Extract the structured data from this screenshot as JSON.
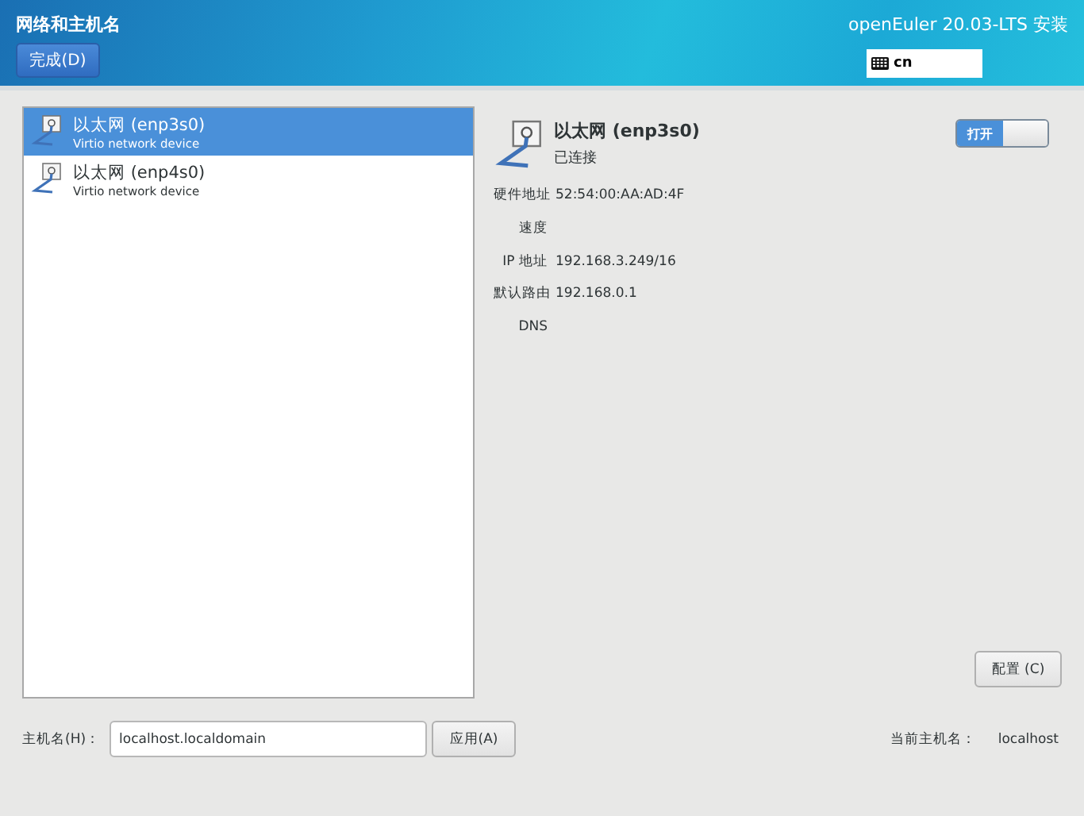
{
  "header": {
    "title": "网络和主机名",
    "done_button": "完成(D)",
    "product": "openEuler 20.03-LTS 安装",
    "keyboard_layout": "cn"
  },
  "devices": [
    {
      "name": "以太网 (enp3s0)",
      "description": "Virtio network device",
      "selected": true
    },
    {
      "name": "以太网 (enp4s0)",
      "description": "Virtio network device",
      "selected": false
    }
  ],
  "details": {
    "name": "以太网 (enp3s0)",
    "status": "已连接",
    "switch": {
      "label": "打开",
      "on": true
    },
    "fields": [
      {
        "label": "硬件地址",
        "value": "52:54:00:AA:AD:4F"
      },
      {
        "label": "速度"
      },
      {
        "label": "IP 地址",
        "value": "192.168.3.249/16"
      },
      {
        "label": "默认路由",
        "value": "192.168.0.1"
      },
      {
        "label": "DNS"
      }
    ],
    "configure_button": "配置 (C)"
  },
  "hostname": {
    "label": "主机名(H)：",
    "value": "localhost.localdomain",
    "apply_button": "应用(A)",
    "current_label": "当前主机名：",
    "current_value": "localhost"
  }
}
